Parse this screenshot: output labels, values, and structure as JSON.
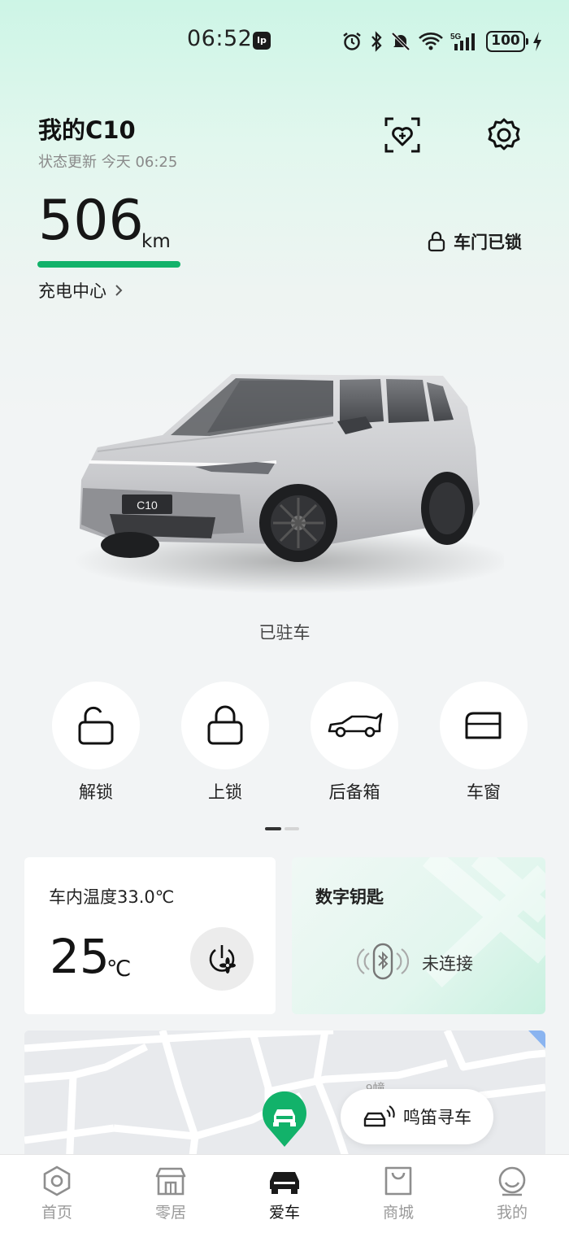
{
  "status_bar": {
    "time": "06:52",
    "app_badge": "lp",
    "battery": "100"
  },
  "header": {
    "title": "我的C10",
    "subtitle": "状态更新 今天 06:25",
    "health_icon": "heart-check-icon",
    "settings_icon": "gear-icon"
  },
  "vehicle": {
    "range_value": "506",
    "range_unit": "km",
    "charge_link": "充电中心",
    "door_status": "车门已锁",
    "plate": "C10",
    "parked_status": "已驻车",
    "accent_color": "#12b26a"
  },
  "quick_actions": [
    {
      "label": "解锁",
      "icon": "unlock-icon"
    },
    {
      "label": "上锁",
      "icon": "lock-icon"
    },
    {
      "label": "后备箱",
      "icon": "trunk-icon"
    },
    {
      "label": "车窗",
      "icon": "window-icon"
    }
  ],
  "climate": {
    "title": "车内温度33.0℃",
    "set_temp": "25",
    "unit": "℃"
  },
  "digital_key": {
    "title": "数字钥匙",
    "status": "未连接"
  },
  "map": {
    "road_label": "9幢",
    "find_car": "鸣笛寻车"
  },
  "nav": {
    "items": [
      {
        "label": "首页",
        "icon": "home-hexagon-icon"
      },
      {
        "label": "零居",
        "icon": "store-icon"
      },
      {
        "label": "爱车",
        "icon": "car-icon",
        "active": true
      },
      {
        "label": "商城",
        "icon": "shopping-bag-icon"
      },
      {
        "label": "我的",
        "icon": "profile-icon"
      }
    ]
  }
}
